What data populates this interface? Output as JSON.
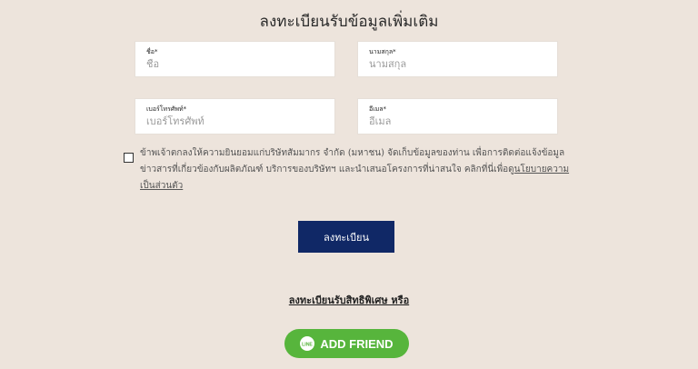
{
  "form": {
    "title": "ลงทะเบียนรับข้อมูลเพิ่มเติม",
    "first_name": {
      "label": "ชื่อ*",
      "placeholder": "ชื่อ"
    },
    "last_name": {
      "label": "นามสกุล*",
      "placeholder": "นามสกุล"
    },
    "phone": {
      "label": "เบอร์โทรศัพท์*",
      "placeholder": "เบอร์โทรศัพท์"
    },
    "email": {
      "label": "อีเมล*",
      "placeholder": "อีเมล"
    },
    "consent_text": "ข้าพเจ้าตกลงให้ความยินยอมแก่บริษัทสัมมากร จำกัด (มหาชน) จัดเก็บข้อมูลของท่าน เพื่อการติดต่อแจ้งข้อมูลข่าวสารที่เกี่ยวข้องกับผลิตภัณฑ์ บริการของบริษัทฯ และนำเสนอโครงการที่น่าสนใจ คลิกที่นี่เพื่อดู",
    "consent_link": "นโยบายความเป็นส่วนตัว",
    "consent_checked": false,
    "submit_label": "ลงทะเบียน"
  },
  "special": {
    "link_label": "ลงทะเบียนรับสิทธิพิเศษ หรือ"
  },
  "line": {
    "button_label": "ADD FRIEND",
    "icon_text": "LINE",
    "brand_color": "#57b53c"
  },
  "colors": {
    "background": "#ede4dc",
    "primary_button": "#102866"
  }
}
